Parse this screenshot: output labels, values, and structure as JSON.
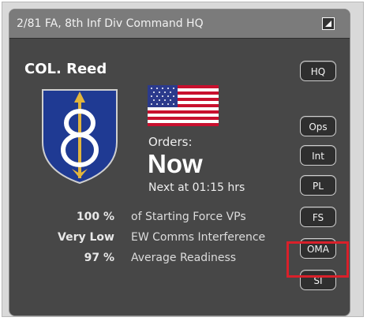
{
  "window": {
    "title": "2/81 FA, 8th Inf Div Command HQ"
  },
  "commander": {
    "name": "COL. Reed",
    "insignia": "8th-infantry-division-patch",
    "flag": "us-flag"
  },
  "orders": {
    "label": "Orders:",
    "value": "Now",
    "next": "Next at 01:15 hrs"
  },
  "stats": [
    {
      "value": "100 %",
      "label": "of Starting Force VPs"
    },
    {
      "value": "Very Low",
      "label": "EW Comms Interference"
    },
    {
      "value": "97 %",
      "label": "Average Readiness"
    }
  ],
  "buttons": {
    "hq": "HQ",
    "ops": "Ops",
    "int": "Int",
    "pl": "PL",
    "fs": "FS",
    "oma": "OMA",
    "si": "SI"
  },
  "colors": {
    "panel": "#474747",
    "titlebar": "#7b7b7b",
    "highlight": "#d9202a",
    "patch_blue": "#1f3a93",
    "patch_gold": "#e2b53c"
  }
}
